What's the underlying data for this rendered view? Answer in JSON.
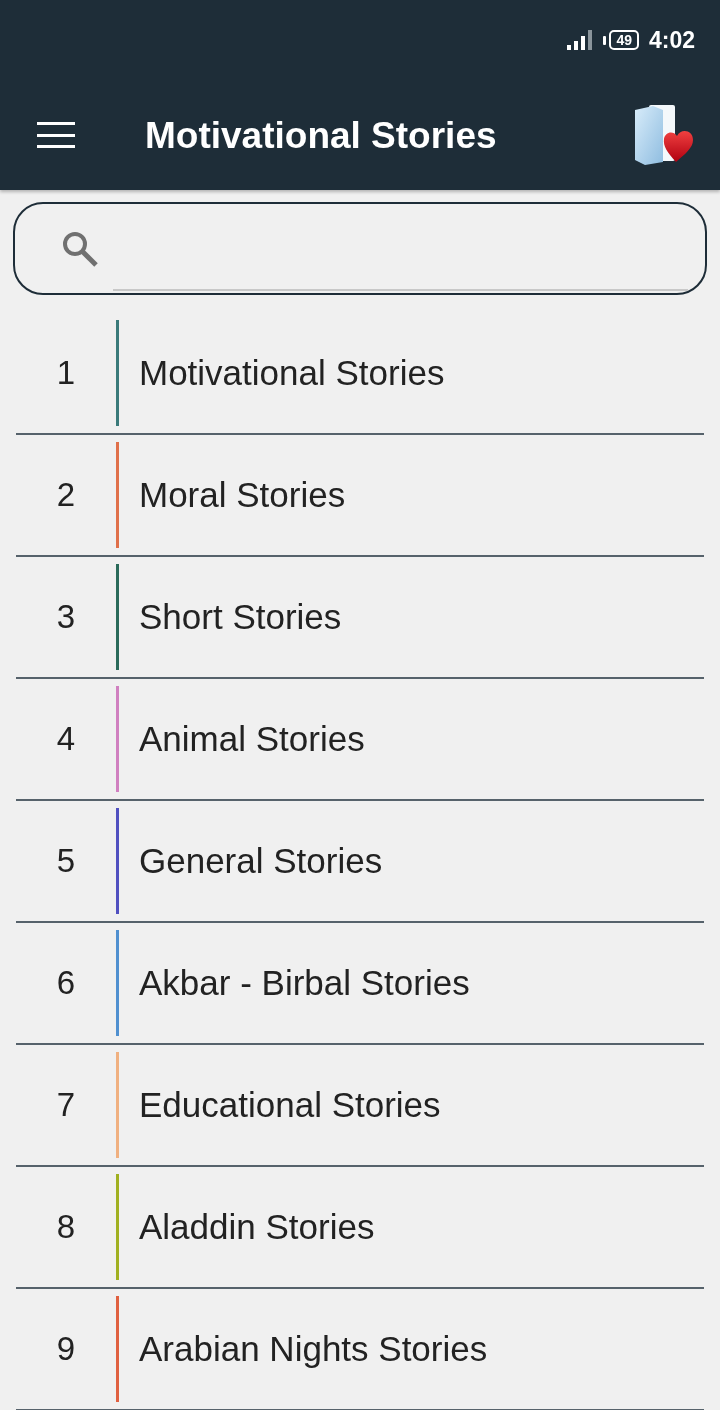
{
  "status_bar": {
    "battery": "49",
    "time": "4:02"
  },
  "app_bar": {
    "title": "Motivational Stories"
  },
  "stories": [
    {
      "number": "1",
      "title": "Motivational Stories",
      "color": "#3a7a7a"
    },
    {
      "number": "2",
      "title": "Moral Stories",
      "color": "#e0704a"
    },
    {
      "number": "3",
      "title": "Short Stories",
      "color": "#2a6a5a"
    },
    {
      "number": "4",
      "title": "Animal Stories",
      "color": "#d080c0"
    },
    {
      "number": "5",
      "title": "General Stories",
      "color": "#5050c0"
    },
    {
      "number": "6",
      "title": "Akbar - Birbal Stories",
      "color": "#5090d0"
    },
    {
      "number": "7",
      "title": "Educational Stories",
      "color": "#f0b080"
    },
    {
      "number": "8",
      "title": "Aladdin Stories",
      "color": "#a0b020"
    },
    {
      "number": "9",
      "title": "Arabian Nights Stories",
      "color": "#e06040"
    }
  ]
}
